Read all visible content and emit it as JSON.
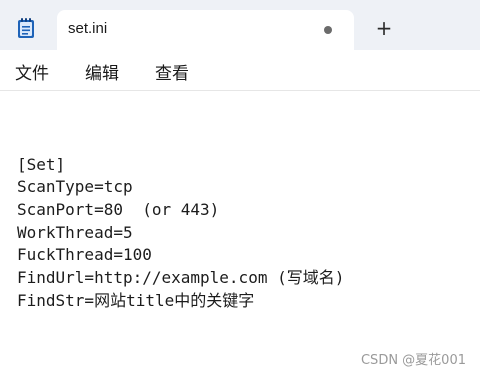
{
  "tab": {
    "title": "set.ini"
  },
  "icons": {
    "app": "notepad-icon",
    "unsaved": "unsaved-dot-icon",
    "new_tab": "plus-icon",
    "new_tab_glyph": "+"
  },
  "menu": {
    "items": [
      "文件",
      "编辑",
      "查看"
    ]
  },
  "editor": {
    "lines": [
      "[Set]",
      "ScanType=tcp",
      "ScanPort=80  (or 443)",
      "WorkThread=5",
      "FuckThread=100",
      "FindUrl=http://example.com (写域名)",
      "FindStr=网站title中的关键字"
    ]
  },
  "watermark": "CSDN @夏花001",
  "colors": {
    "titlebar_bg": "#eef1f6",
    "tab_bg": "#ffffff",
    "icon_blue": "#1e63b8"
  }
}
